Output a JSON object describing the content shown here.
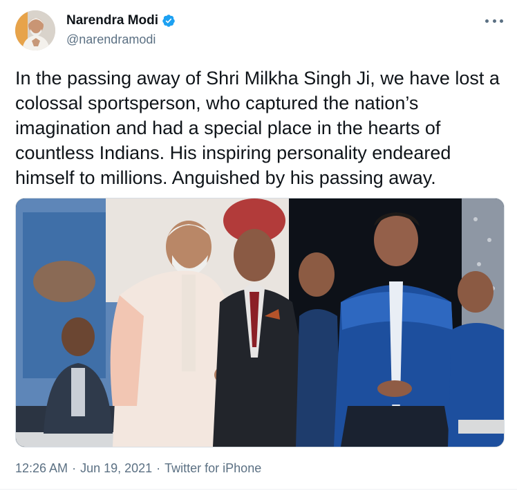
{
  "author": {
    "name": "Narendra Modi",
    "handle": "@narendramodi",
    "verified_icon": "verified-badge-icon",
    "verified_color": "#1da1f2"
  },
  "tweet": {
    "text": "In the passing away of Shri Milkha Singh Ji, we have lost a\ncolossal sportsperson, who captured the nation’s\nimagination and had a special place in the hearts of\ncountless Indians. His inspiring personality endeared\nhimself to millions. Anguished by his passing away.",
    "more_icon": "more-options-icon"
  },
  "media": {
    "kind": "photo",
    "subject": "photo-of-two-men-shaking-hands-on-stage"
  },
  "meta": {
    "time": "12:26 AM",
    "separator": "·",
    "date": "Jun 19, 2021",
    "source": "Twitter for iPhone"
  },
  "colors": {
    "text": "#0f1419",
    "secondary": "#5b7083",
    "accent": "#1da1f2"
  }
}
